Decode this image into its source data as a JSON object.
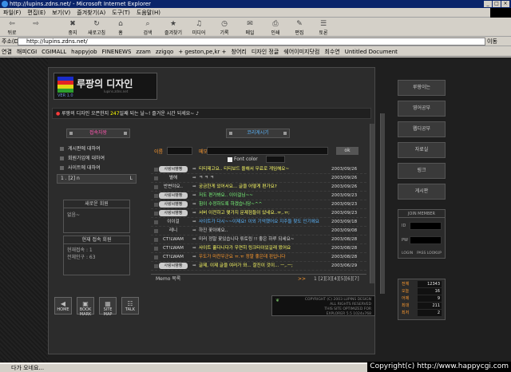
{
  "window": {
    "title": "http://lupins.zdns.net/ - Microsoft Internet Explorer",
    "controls": [
      "_",
      "□",
      "×"
    ]
  },
  "menu": [
    "파일(F)",
    "편집(E)",
    "보기(V)",
    "즐겨찾기(A)",
    "도구(T)",
    "도움말(H)"
  ],
  "toolbar": [
    {
      "label": "뒤로",
      "icon": "back-icon",
      "glyph": "⇦"
    },
    {
      "label": "",
      "icon": "forward-icon",
      "glyph": "⇨"
    },
    {
      "label": "중지",
      "icon": "stop-icon",
      "glyph": "✖"
    },
    {
      "label": "새로고침",
      "icon": "refresh-icon",
      "glyph": "↻"
    },
    {
      "label": "홈",
      "icon": "home-icon",
      "glyph": "⌂"
    },
    {
      "label": "검색",
      "icon": "search-icon",
      "glyph": "⌕"
    },
    {
      "label": "즐겨찾기",
      "icon": "favorites-icon",
      "glyph": "★"
    },
    {
      "label": "미디어",
      "icon": "media-icon",
      "glyph": "♫"
    },
    {
      "label": "기록",
      "icon": "history-icon",
      "glyph": "◷"
    },
    {
      "label": "메일",
      "icon": "mail-icon",
      "glyph": "✉"
    },
    {
      "label": "인쇄",
      "icon": "print-icon",
      "glyph": "⎙"
    },
    {
      "label": "편집",
      "icon": "edit-icon",
      "glyph": "✎"
    },
    {
      "label": "토론",
      "icon": "discuss-icon",
      "glyph": "☰"
    }
  ],
  "address": {
    "label": "주소(D)",
    "url": "http://lupins.zdns.net/",
    "go": "이동"
  },
  "links": [
    "연결",
    "해피CGI",
    "CGIMALL",
    "happyjob",
    "FINENEWS",
    "zzam",
    "zzigqo",
    "+ geston,pe,kr +",
    "창어리",
    "디자인 정글",
    "쉐어이미지닷컴",
    "최수연",
    "Untitled Document"
  ],
  "site": {
    "logo_title": "루팡의 디자인",
    "logo_sub": "VER 1.0",
    "logo_url": "lupins.zdns.net",
    "flag_colors": [
      "#1c2cc9",
      "#e32323",
      "#e3d617",
      "#2e9e2e"
    ],
    "announce_pre": "루팡의 디자인 오픈한지 ",
    "announce_num": "247",
    "announce_post": "일째 되는 날~! 즐거운 시간 되세요~ ♪",
    "tab_left": "접속자왕",
    "tab_right": "코리게시기",
    "left_menu": [
      "게시판에 대하여",
      "회원가입에 대하여",
      "사이트에 대하여"
    ],
    "login_row": "1 . [2] n",
    "login_btn": "L",
    "new_member_title": "새로운 회원",
    "new_member_text": "없음~",
    "current_title": "현재 접속 회원",
    "current_lines": [
      "현재접속 : 1",
      "전체인구 : 63"
    ]
  },
  "guestbook": {
    "name_label": "이름",
    "msg_label": "메모",
    "ok": "ok",
    "font_color": "Font color",
    "rows": [
      {
        "name": "사랑씨빵빵",
        "badge": true,
        "msg": "티티제고요.. 티티보드 올해서 무료로 게임해요~",
        "color": "#ffff66",
        "date": "2003/09/26"
      },
      {
        "name": "별해",
        "badge": false,
        "msg": "ㅋ ㅋ ㅋ",
        "color": "#dddddd",
        "date": "2003/09/26"
      },
      {
        "name": "반변야요..",
        "badge": false,
        "msg": "궁금한게 있어서요... 글을 어떻게 편가요?",
        "color": "#ffff66",
        "date": "2003/09/26"
      },
      {
        "name": "사랑씨빵빵",
        "badge": true,
        "msg": "저도 편가봐요.. 이이걸님~~",
        "color": "#7dff7d",
        "date": "2003/09/23"
      },
      {
        "name": "사랑씨빵빵",
        "badge": true,
        "msg": "힘이 수정하도록 하겠습니당~^^",
        "color": "#7dff7d",
        "date": "2003/09/23"
      },
      {
        "name": "사랑씨빵빵",
        "badge": true,
        "msg": "서버 이전하고 몇가지 문제점들이 있네요..ㅠ,.ㅠ;",
        "color": "#ffff66",
        "date": "2003/09/23"
      },
      {
        "name": "이이걸",
        "badge": false,
        "msg": "사이트가 다시~~이제요! 이외 기억했어요 지주들 찾도 인기에요",
        "color": "#5bb7ff",
        "date": "2003/09/18"
      },
      {
        "name": "레니",
        "badge": false,
        "msg": "하진 꽃이에요..",
        "color": "#dddddd",
        "date": "2003/09/08"
      },
      {
        "name": "CT!LWAM",
        "badge": false,
        "msg": "미러 정말 꽃있습니다 튜토링 !! 좋은 하루 되세요~",
        "color": "#dddddd",
        "date": "2003/08/28"
      },
      {
        "name": "CT!LWAM",
        "badge": false,
        "msg": "사이트 훌다니다가 우연히 링크타이있길래 왔어요",
        "color": "#ffff66",
        "date": "2003/08/28"
      },
      {
        "name": "CT!LWAM",
        "badge": false,
        "msg": "우도가 마찬우군요 ㅠ.ㅠ 정말 좋은데 핀입니다",
        "color": "#ff9b2f",
        "date": "2003/08/28"
      },
      {
        "name": "사랑씨빵빵",
        "badge": true,
        "msg": "글제, 이제 글을 여러가 와... 잘진이 것이... ㅡ,.ㅡ;",
        "color": "#ffff66",
        "date": "2003/06/29"
      }
    ],
    "memo_label": "Memo 목록",
    "next": ">>",
    "pages": "1 [2][3][4][5][6][7]"
  },
  "bottom_icons": [
    {
      "label": "HOME",
      "icon": "home-icon",
      "glyph": "◀"
    },
    {
      "label": "BOOK MARK",
      "icon": "bookmark-icon",
      "glyph": "▣"
    },
    {
      "label": "SITE MAP",
      "icon": "sitemap-icon",
      "glyph": "▦"
    },
    {
      "label": "TALK",
      "icon": "talk-icon",
      "glyph": "☷"
    }
  ],
  "footer": {
    "line1": "COPYRIGHT (C) 2003 LUPINS DESIGN",
    "line2": "ALL RIGHTS RESERVED",
    "line3": "THIS SITE OPTIMIZED FOR",
    "line4": "EXPLORER 5.5 1024x768"
  },
  "right_menu": [
    "루팡이는",
    "영어공부",
    "웹디공부",
    "자료실",
    "링크",
    "게시판"
  ],
  "login_box": {
    "title": "JOIN MEMBER",
    "id_label": "ID",
    "pw_label": "PW",
    "link1": "LOGIN",
    "link2": "PASS LOOKUP"
  },
  "stats": [
    {
      "k": "전체",
      "v": "12343"
    },
    {
      "k": "오늘",
      "v": "16"
    },
    {
      "k": "어제",
      "v": "9"
    },
    {
      "k": "최대",
      "v": "211"
    },
    {
      "k": "최저",
      "v": "2"
    }
  ],
  "status": "다가 오네요...",
  "copyright": "Copyright(c) http://www.happycgi.com"
}
